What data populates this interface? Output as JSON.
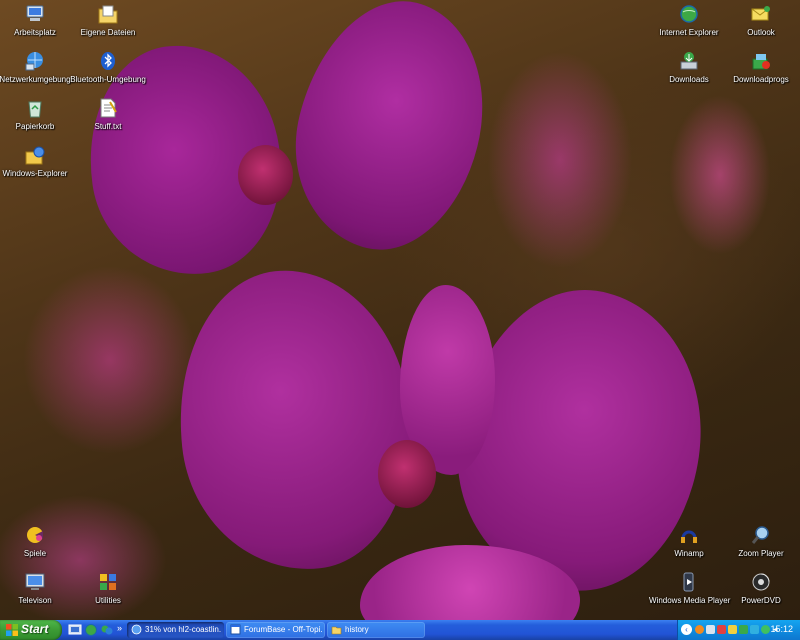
{
  "desktop": {
    "icons": [
      {
        "label": "Arbeitsplatz",
        "icon": "my-computer-icon"
      },
      {
        "label": "Eigene Dateien",
        "icon": "my-documents-icon"
      },
      {
        "label": "Netzwerkumgebung",
        "icon": "network-places-icon"
      },
      {
        "label": "Bluetooth-Umgebung",
        "icon": "bluetooth-icon"
      },
      {
        "label": "Papierkorb",
        "icon": "recycle-bin-icon"
      },
      {
        "label": "Stuff.txt",
        "icon": "text-file-icon"
      },
      {
        "label": "Windows-Explorer",
        "icon": "windows-explorer-icon"
      },
      {
        "label": "Internet Explorer",
        "icon": "internet-explorer-icon"
      },
      {
        "label": "Outlook",
        "icon": "outlook-icon"
      },
      {
        "label": "Downloads",
        "icon": "downloads-folder-icon"
      },
      {
        "label": "Downloadprogs",
        "icon": "downloadprogs-icon"
      },
      {
        "label": "Spiele",
        "icon": "games-icon"
      },
      {
        "label": "Televison",
        "icon": "television-icon"
      },
      {
        "label": "Utilities",
        "icon": "utilities-icon"
      },
      {
        "label": "Winamp",
        "icon": "winamp-icon"
      },
      {
        "label": "Zoom Player",
        "icon": "zoom-player-icon"
      },
      {
        "label": "Windows Media Player",
        "icon": "windows-media-player-icon"
      },
      {
        "label": "PowerDVD",
        "icon": "powerdvd-icon"
      }
    ]
  },
  "taskbar": {
    "start_label": "Start",
    "quick_launch": [
      "show-desktop-icon",
      "internet-explorer-icon",
      "msn-icon"
    ],
    "tasks": [
      {
        "label": "31% von hl2-coastlin...",
        "icon": "browser-download-icon",
        "active": true
      },
      {
        "label": "ForumBase - Off-Topi...",
        "icon": "browser-window-icon",
        "active": false
      },
      {
        "label": "history",
        "icon": "folder-icon",
        "active": false
      }
    ],
    "tray_icons": [
      "tray-back-icon",
      "tray-firefox-icon",
      "tray-network-icon",
      "tray-security-icon",
      "tray-antivirus-icon",
      "tray-shield-icon",
      "tray-messenger-icon",
      "tray-volume-icon",
      "tray-update-icon"
    ],
    "clock": "15:12"
  },
  "colors": {
    "taskbar_blue": "#245edb",
    "start_green": "#3c9b35",
    "tray_blue": "#0f8ce0",
    "orchid": "#b02a9a"
  }
}
